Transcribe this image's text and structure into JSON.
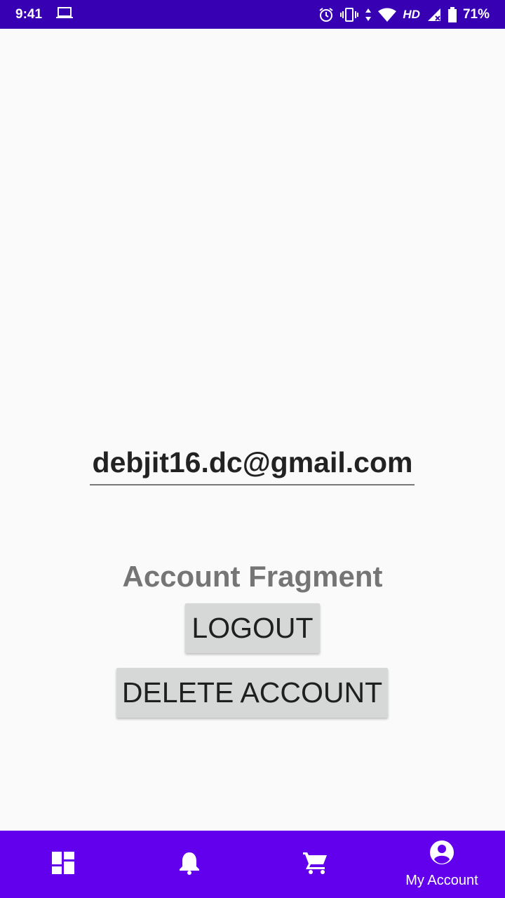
{
  "status_bar": {
    "time": "9:41",
    "network": "HD",
    "battery": "71%",
    "icons": [
      "laptop-icon",
      "alarm-icon",
      "vibrate-icon",
      "data-arrows-icon",
      "wifi-icon",
      "signal-icon",
      "battery-icon"
    ]
  },
  "account": {
    "email": "debjit16.dc@gmail.com",
    "title": "Account Fragment",
    "logout_label": "LOGOUT",
    "delete_label": "DELETE ACCOUNT"
  },
  "bottom_nav": {
    "items": [
      {
        "icon": "dashboard-icon",
        "label": ""
      },
      {
        "icon": "bell-icon",
        "label": ""
      },
      {
        "icon": "cart-icon",
        "label": ""
      },
      {
        "icon": "account-circle-icon",
        "label": "My Account",
        "selected": true
      }
    ]
  },
  "colors": {
    "status_bar": "#3700b3",
    "bottom_nav": "#6200ee",
    "button_bg": "#d6d7d7",
    "background": "#fafafa"
  }
}
